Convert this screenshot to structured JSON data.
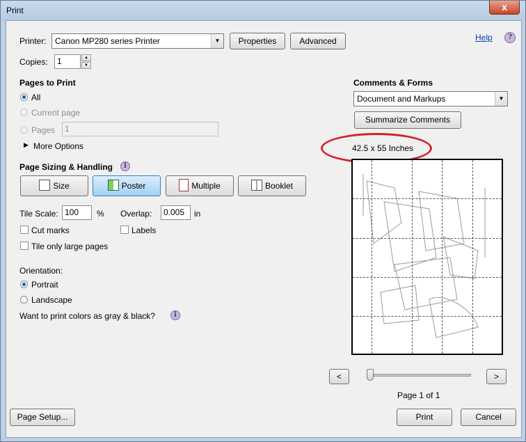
{
  "window": {
    "title": "Print",
    "close_label": "x"
  },
  "help_label": "Help",
  "printer": {
    "label": "Printer:",
    "value": "Canon MP280 series Printer",
    "properties_label": "Properties",
    "advanced_label": "Advanced"
  },
  "copies": {
    "label": "Copies:",
    "value": "1"
  },
  "pages_to_print": {
    "heading": "Pages to Print",
    "all_label": "All",
    "current_label": "Current page",
    "pages_label": "Pages",
    "pages_value": "1",
    "more_options_label": "More Options"
  },
  "sizing": {
    "heading": "Page Sizing & Handling",
    "tabs": {
      "size": "Size",
      "poster": "Poster",
      "multiple": "Multiple",
      "booklet": "Booklet"
    },
    "tile_scale_label": "Tile Scale:",
    "tile_scale_value": "100",
    "percent_label": "%",
    "overlap_label": "Overlap:",
    "overlap_value": "0.005",
    "overlap_unit": "in",
    "cut_marks_label": "Cut marks",
    "labels_label": "Labels",
    "tile_large_label": "Tile only large pages"
  },
  "orientation": {
    "heading": "Orientation:",
    "portrait_label": "Portrait",
    "landscape_label": "Landscape"
  },
  "gray_question": "Want to print colors as gray & black?",
  "comments": {
    "heading": "Comments & Forms",
    "value": "Document and Markups",
    "summarize_label": "Summarize Comments"
  },
  "preview": {
    "size_text": "42.5 x 55 Inches",
    "page_text": "Page 1 of 1",
    "prev_label": "<",
    "next_label": ">"
  },
  "footer": {
    "page_setup_label": "Page Setup...",
    "print_label": "Print",
    "cancel_label": "Cancel"
  },
  "colors": {
    "annotation_oval": "#d3232a",
    "selected_tab": "#9fd0f5",
    "link": "#0645ad"
  }
}
